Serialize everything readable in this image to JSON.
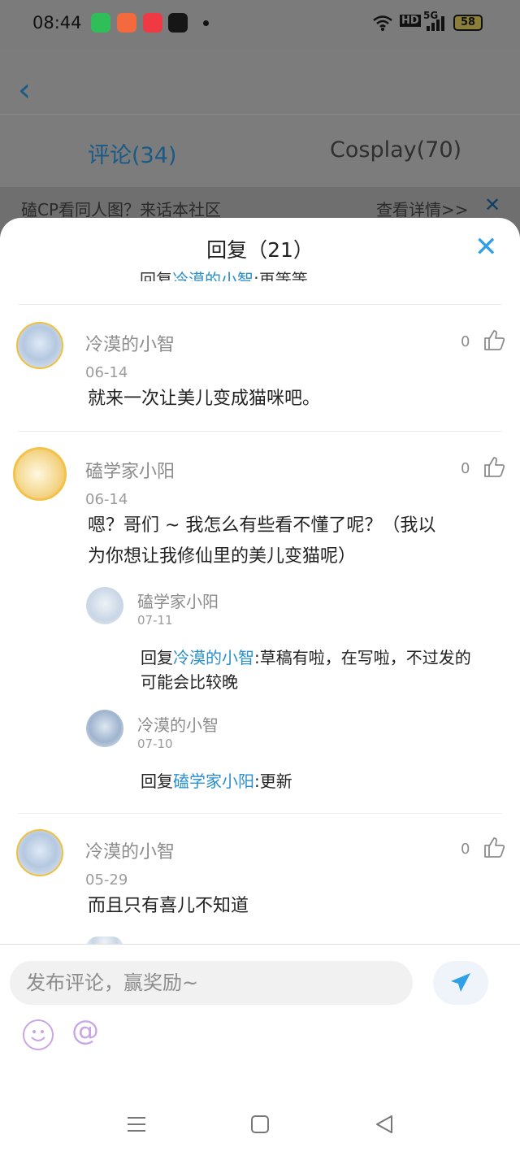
{
  "status_bar": {
    "time": "08:44",
    "app_icons": [
      "video-app-icon",
      "shopping-app-icon",
      "red-app-icon",
      "tiktok-icon"
    ],
    "hd_label": "HD",
    "signal_label": "5G",
    "battery": "58"
  },
  "background_page": {
    "tabs": [
      {
        "label": "评论(34)"
      },
      {
        "label": "Cosplay(70)"
      }
    ],
    "banner": {
      "text": "磕CP看同人图？来话本社区",
      "detail_link": "查看详情>>",
      "close": "✕"
    }
  },
  "reply_sheet": {
    "title": "回复（21）",
    "close": "✕",
    "clipped_line": {
      "prefix": "回复",
      "name": "冷漠的小智",
      "text": ":再等等"
    },
    "comments": [
      {
        "name": "冷漠的小智",
        "date": "06-14",
        "text": "就来一次让美儿变成猫咪吧。",
        "likes": "0"
      },
      {
        "name": "磕学家小阳",
        "date": "06-14",
        "text_line1": "嗯？哥们 ~ 我怎么有些看不懂了呢？（我以",
        "text_line2": "为你想让我修仙里的美儿变猫呢）",
        "likes": "0",
        "replies": [
          {
            "name": "磕学家小阳",
            "date": "07-11",
            "prefix": "回复",
            "target": "冷漠的小智",
            "text_line1": ":草稿有啦，在写啦，不过发的",
            "text_line2": "可能会比较晚"
          },
          {
            "name": "冷漠的小智",
            "date": "07-10",
            "prefix": "回复",
            "target": "磕学家小阳",
            "text_line1": ":更新"
          }
        ]
      },
      {
        "name": "冷漠的小智",
        "date": "05-29",
        "text": "而且只有喜儿不知道",
        "likes": "0"
      }
    ]
  },
  "input_bar": {
    "placeholder": "发布评论，赢奖励~",
    "at_symbol": "@"
  },
  "colors": {
    "accent": "#2f9fe8",
    "link": "#2a8fcb",
    "tab_active": "#1a5a86"
  }
}
